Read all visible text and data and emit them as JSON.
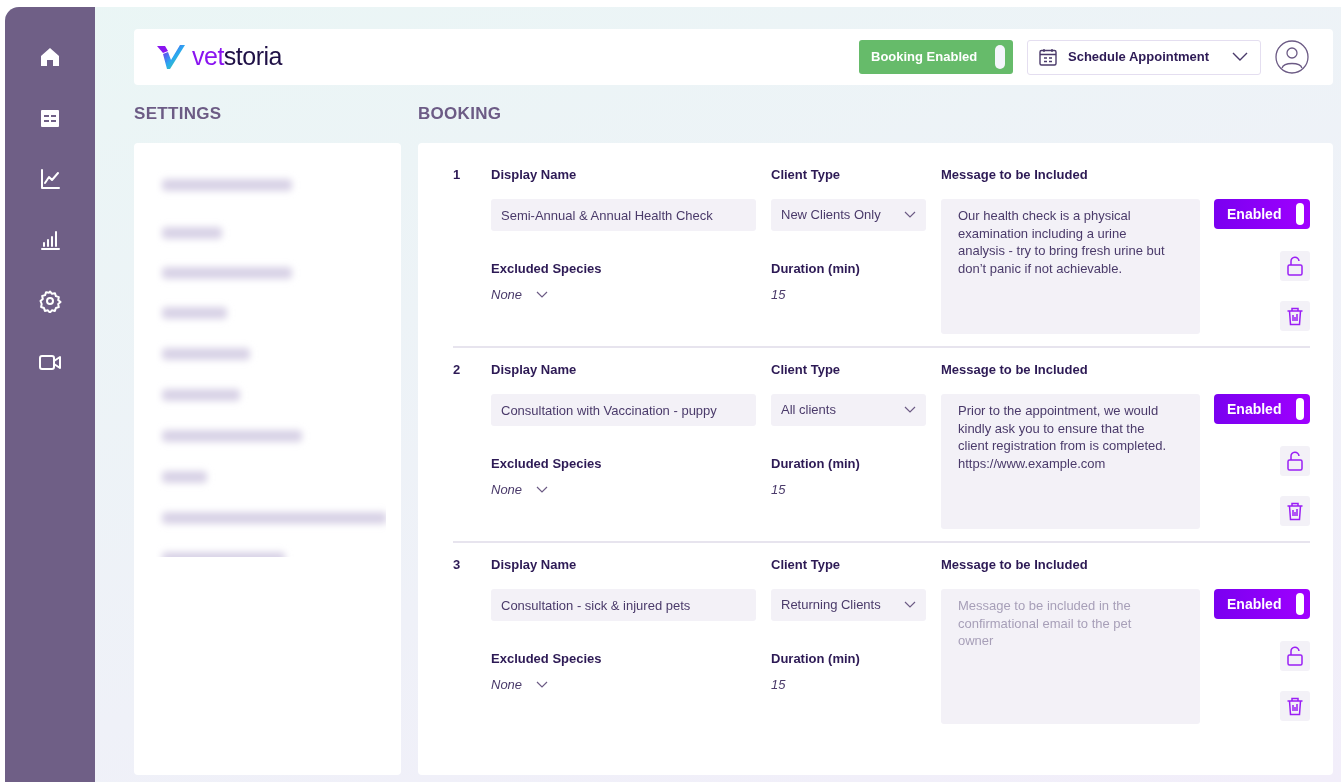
{
  "header": {
    "logo": {
      "accent": "vet",
      "rest": "storia"
    },
    "booking_toggle": {
      "label": "Booking Enabled",
      "on": true
    },
    "schedule_dropdown": {
      "label": "Schedule Appointment"
    }
  },
  "settings": {
    "title": "SETTINGS"
  },
  "booking": {
    "title": "BOOKING",
    "services": [
      {
        "number": "1",
        "display_name_label": "Display Name",
        "display_name": "Semi-Annual & Annual Health Check",
        "client_type_label": "Client Type",
        "client_type": "New Clients Only",
        "message_label": "Message to be Included",
        "message": "Our health check is a physical examination including a urine analysis - try to bring fresh urine but don’t panic if not achievable.",
        "excluded_species_label": "Excluded Species",
        "excluded_species": "None",
        "duration_label": "Duration (min)",
        "duration": "15",
        "toggle_label": "Enabled",
        "enabled": true
      },
      {
        "number": "2",
        "display_name_label": "Display Name",
        "display_name": "Consultation with Vaccination - puppy",
        "client_type_label": "Client Type",
        "client_type": "All clients",
        "message_label": "Message to be Included",
        "message": "Prior to the appointment, we would kindly ask you to ensure that the client registration from is completed.\nhttps://www.example.com",
        "excluded_species_label": "Excluded Species",
        "excluded_species": "None",
        "duration_label": "Duration (min)",
        "duration": "15",
        "toggle_label": "Enabled",
        "enabled": true
      },
      {
        "number": "3",
        "display_name_label": "Display Name",
        "display_name": "Consultation - sick & injured pets",
        "client_type_label": "Client Type",
        "client_type": "Returning Clients",
        "message_label": "Message to be Included",
        "placeholder": "Message to be included in the confirmational email to the pet owner",
        "excluded_species_label": "Excluded Species",
        "excluded_species": "None",
        "duration_label": "Duration (min)",
        "duration": "15",
        "toggle_label": "Enabled",
        "enabled": true
      }
    ]
  }
}
